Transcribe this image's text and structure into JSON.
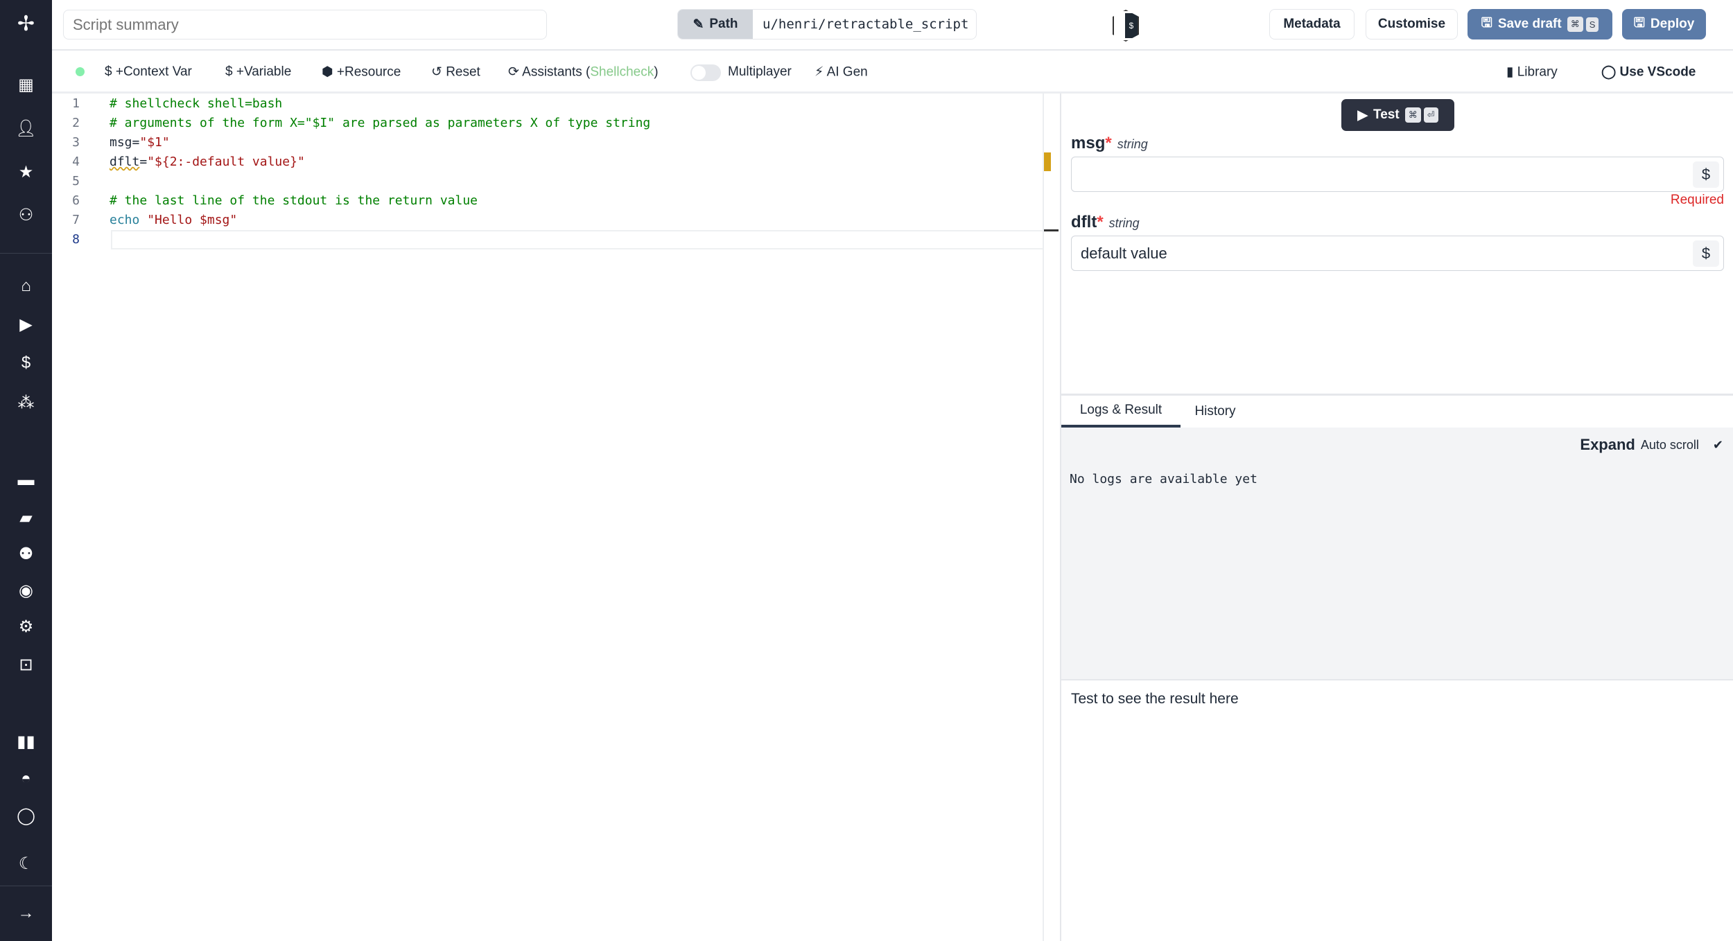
{
  "sidebar": {
    "top_icons": [
      "dashboard-icon",
      "user-icon",
      "star-icon",
      "users-icon"
    ],
    "main_icons": [
      "home-icon",
      "play-icon",
      "dollar-icon",
      "cubes-icon"
    ],
    "more_icons": [
      "calendar-icon",
      "folder-icon",
      "groups-icon",
      "eye-icon",
      "gear-icon",
      "robot-icon"
    ],
    "bottom_icons": [
      "book-icon",
      "discord-icon",
      "github-icon",
      "moon-icon",
      "arrow-right-icon"
    ]
  },
  "header": {
    "summary_placeholder": "Script summary",
    "path_label": "Path",
    "path_value": "u/henri/retractable_script",
    "metadata": "Metadata",
    "customise": "Customise",
    "save_draft": "Save draft",
    "save_kbd1": "⌘",
    "save_kbd2": "S",
    "deploy": "Deploy",
    "accent": "#5b7ba8"
  },
  "toolbar": {
    "context_var": "+Context Var",
    "variable": "+Variable",
    "resource": "+Resource",
    "reset": "Reset",
    "assistants": "Assistants (",
    "shellcheck": "Shellcheck",
    "assistants_close": ")",
    "multiplayer": "Multiplayer",
    "multiplayer_on": false,
    "ai_gen": "AI Gen",
    "library": "Library",
    "use_vscode": "Use VScode",
    "status_color": "#86efac"
  },
  "editor": {
    "lines": [
      [
        {
          "t": "# shellcheck shell=bash",
          "c": "cm"
        }
      ],
      [
        {
          "t": "# arguments of the form X=\"$I\" are parsed as parameters X of type string",
          "c": "cm"
        }
      ],
      [
        {
          "t": "msg=",
          "c": ""
        },
        {
          "t": "\"$1\"",
          "c": "str"
        }
      ],
      [
        {
          "t": "dflt",
          "c": "warn"
        },
        {
          "t": "=",
          "c": ""
        },
        {
          "t": "\"${2:-default value}\"",
          "c": "str"
        }
      ],
      [],
      [
        {
          "t": "# the last line of the stdout is the return value",
          "c": "cm"
        }
      ],
      [
        {
          "t": "echo ",
          "c": "kw"
        },
        {
          "t": "\"Hello $msg\"",
          "c": "str"
        }
      ],
      []
    ],
    "line_numbers": [
      "1",
      "2",
      "3",
      "4",
      "5",
      "6",
      "7",
      "8"
    ]
  },
  "panel": {
    "test": "Test",
    "test_kbd1": "⌘",
    "test_kbd2": "⏎",
    "fields": [
      {
        "name": "msg",
        "type": "string",
        "value": "",
        "error": "Required"
      },
      {
        "name": "dflt",
        "type": "string",
        "value": "default value"
      }
    ],
    "tabs": [
      "Logs & Result",
      "History"
    ],
    "expand": "Expand",
    "auto_scroll": "Auto scroll",
    "check": "✔",
    "no_logs": "No logs are available yet",
    "result_placeholder": "Test to see the result here"
  }
}
